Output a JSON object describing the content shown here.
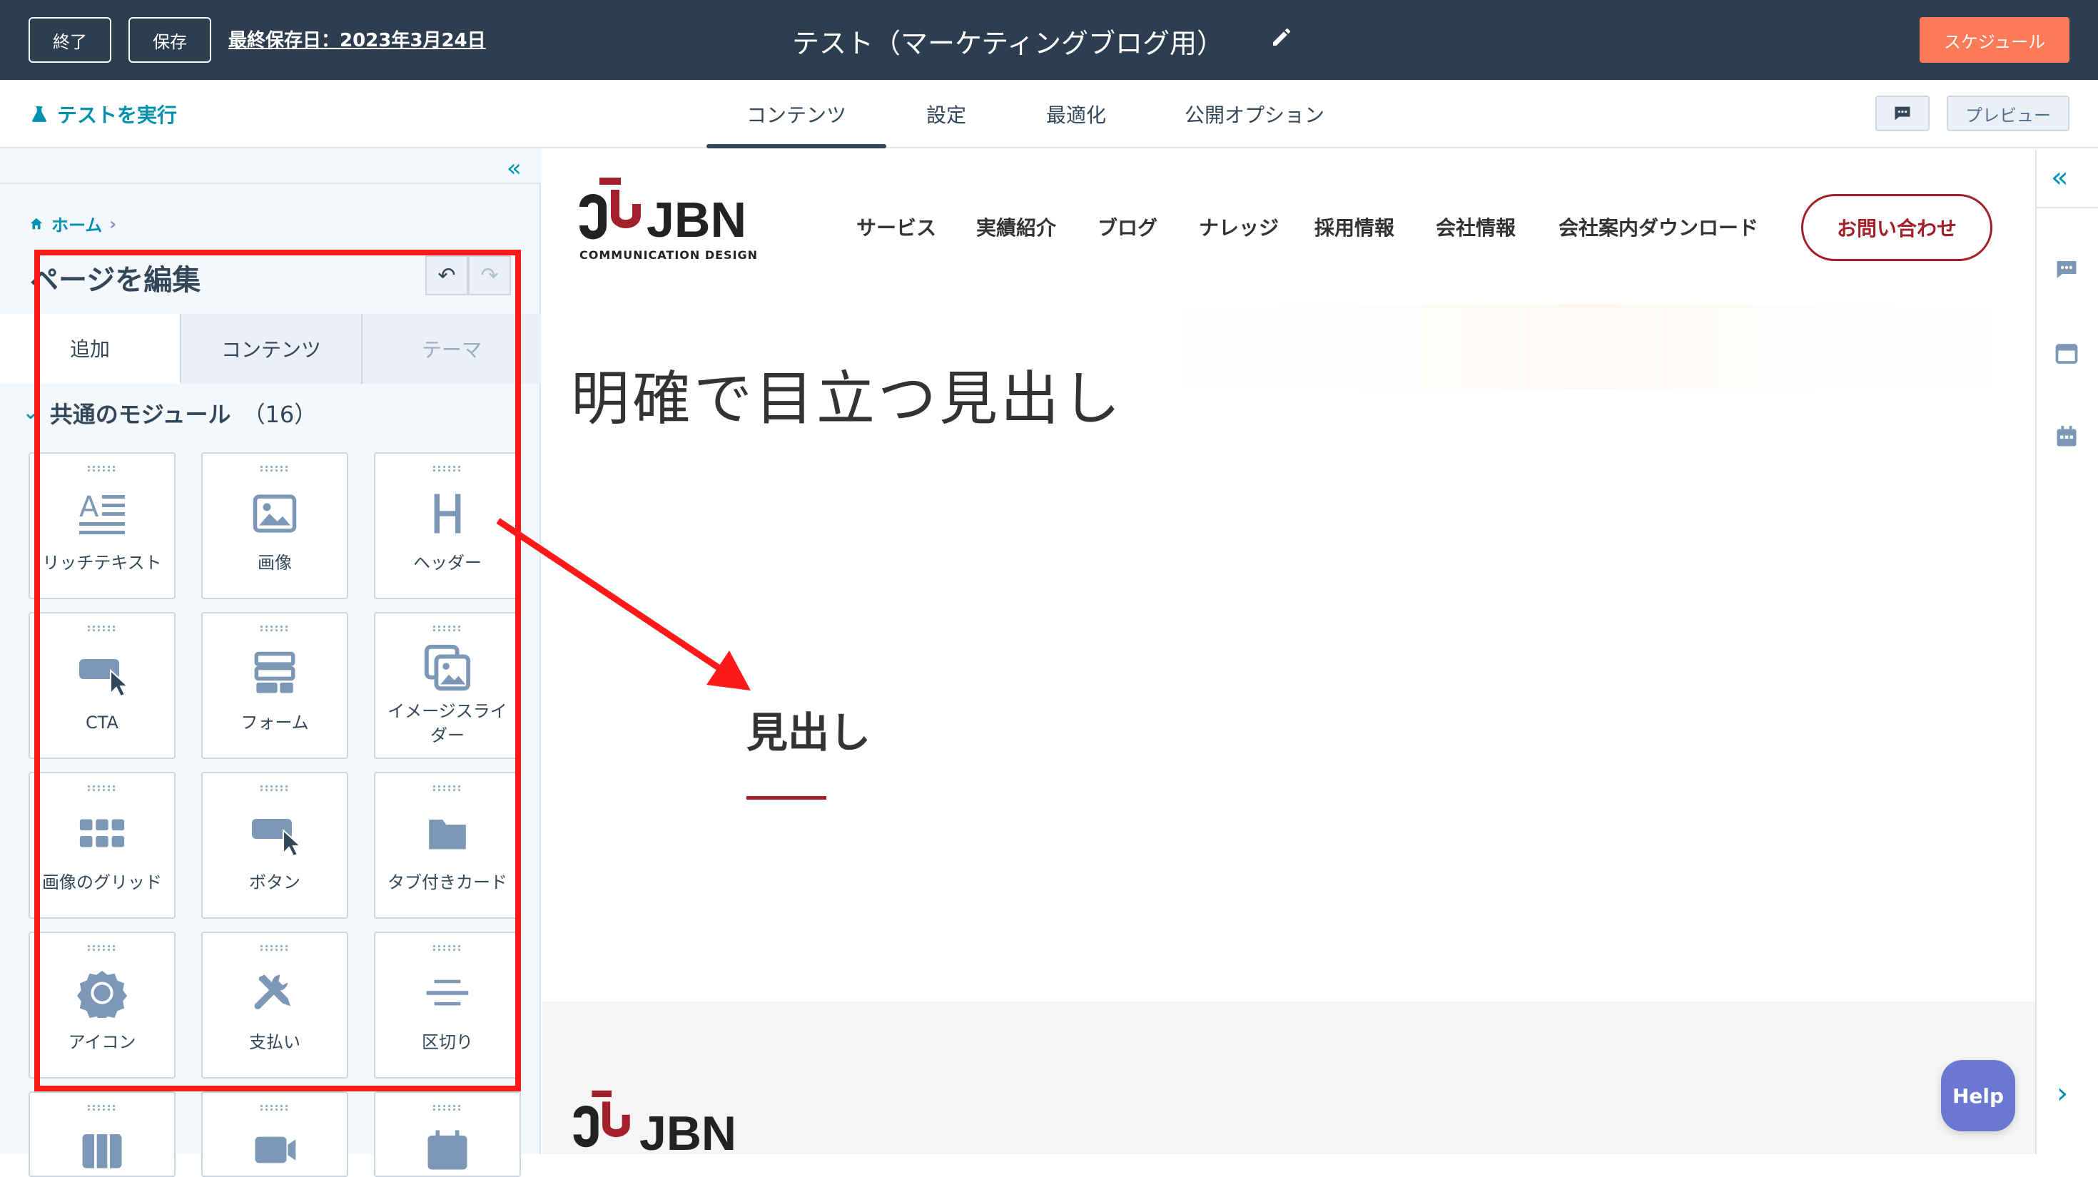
{
  "topbar": {
    "exit_label": "終了",
    "save_label": "保存",
    "last_saved": "最終保存日：2023年3月24日",
    "title": "テスト（マーケティングブログ用）",
    "schedule_label": "スケジュール"
  },
  "subbar": {
    "run_test": "テストを実行",
    "tabs": [
      "コンテンツ",
      "設定",
      "最適化",
      "公開オプション"
    ],
    "active_tab": "コンテンツ",
    "preview_label": "プレビュー"
  },
  "sidebar": {
    "breadcrumb": "ホーム",
    "heading": "ページを編集",
    "panel_tabs": [
      "追加",
      "コンテンツ",
      "テーマ"
    ],
    "module_group": "共通のモジュール",
    "module_count": "（16）",
    "modules": [
      {
        "label": "リッチテキスト",
        "icon": "rich-text-icon"
      },
      {
        "label": "画像",
        "icon": "image-icon"
      },
      {
        "label": "ヘッダー",
        "icon": "header-icon"
      },
      {
        "label": "CTA",
        "icon": "cta-icon"
      },
      {
        "label": "フォーム",
        "icon": "form-icon"
      },
      {
        "label": "イメージスライダー",
        "icon": "image-slider-icon"
      },
      {
        "label": "画像のグリッド",
        "icon": "image-grid-icon"
      },
      {
        "label": "ボタン",
        "icon": "button-icon"
      },
      {
        "label": "タブ付きカード",
        "icon": "tabbed-card-icon"
      },
      {
        "label": "アイコン",
        "icon": "badge-icon"
      },
      {
        "label": "支払い",
        "icon": "tools-icon"
      },
      {
        "label": "区切り",
        "icon": "divider-icon"
      }
    ]
  },
  "site": {
    "logo_text": "JBN",
    "logo_sub": "COMMUNICATION DESIGN",
    "nav": [
      "サービス",
      "実績紹介",
      "ブログ",
      "ナレッジ",
      "採用情報",
      "会社情報",
      "会社案内ダウンロード"
    ],
    "contact_label": "お問い合わせ",
    "hero_title": "明確で目立つ見出し",
    "sub_heading": "見出し",
    "accent_color": "#a31f2a"
  },
  "help_label": "Help",
  "colors": {
    "topbar": "#2d3e50",
    "schedule": "#ff7a59",
    "link": "#0091ae",
    "annotation": "#ff1a1a",
    "help": "#6a78d1"
  }
}
